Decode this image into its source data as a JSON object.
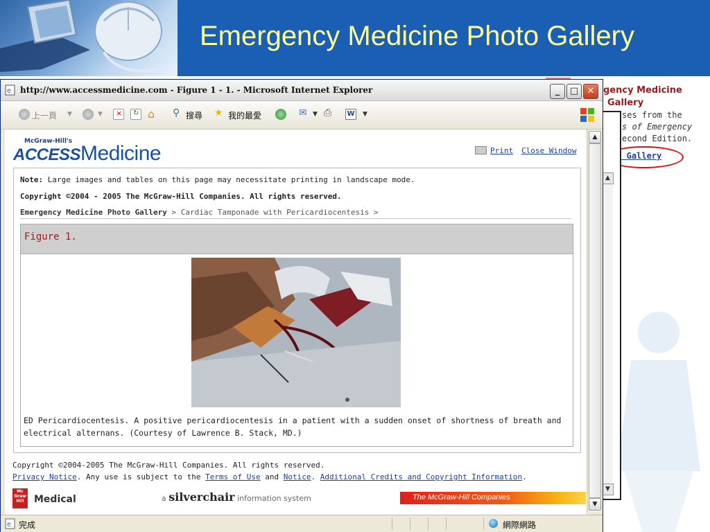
{
  "slide": {
    "title": "Emergency Medicine Photo Gallery"
  },
  "background_page": {
    "title_line1": "gency Medicine",
    "title_line2": "Gallery",
    "text_line1": "ses from the",
    "text_line2": "s of Emergency",
    "text_line3": "econd Edition.",
    "link": "to Gallery"
  },
  "window": {
    "title": "http://www.accessmedicine.com - Figure 1 - 1. - Microsoft Internet Explorer",
    "minimize": "_",
    "maximize": "□",
    "close": "✕"
  },
  "toolbar": {
    "back_label": "上一頁",
    "search_label": "搜尋",
    "favorites_label": "我的最愛"
  },
  "page": {
    "logo_small": "McGraw-Hill's",
    "logo_access": "ACCESS",
    "logo_medicine": "Medicine",
    "print_label": "Print",
    "close_window_label": "Close Window",
    "note_label": "Note:",
    "note_text": "Large images and tables on this page may necessitate printing in landscape mode.",
    "copyright_top": "Copyright ©2004 - 2005 The McGraw-Hill Companies.  All rights reserved.",
    "breadcrumb_home": "Emergency Medicine Photo Gallery",
    "breadcrumb_rest": " > Cardiac Tamponade with Pericardiocentesis >",
    "figure_title": "Figure 1.",
    "caption": "ED Pericardiocentesis. A positive pericardiocentesis in a patient with a sudden onset of shortness of breath and electrical alternans. (Courtesy of Lawrence B. Stack, MD.)",
    "footer_copyright": "Copyright ©2004-2005 The McGraw-Hill Companies.  All rights reserved.",
    "footer_privacy": "Privacy Notice",
    "footer_text1": ". Any use is subject to the ",
    "footer_terms": "Terms of Use",
    "footer_and": " and ",
    "footer_notice": "Notice",
    "footer_dot": ".  ",
    "footer_credits": "Additional Credits and Copyright Information",
    "footer_end": ".",
    "mcgraw_logo": "Mc Graw Hill",
    "medical": "Medical",
    "silverchair_a": "a ",
    "silverchair_name": "silverchair",
    "silverchair_rest": " information system",
    "mh_companies": "The McGraw-Hill Companies"
  },
  "status": {
    "text": "完成",
    "zone": "網際網路"
  },
  "colors": {
    "slide_header": "#1a5fb4",
    "slide_title": "#ffff99",
    "link": "#1c3f9c",
    "figure_title": "#9b1a1a"
  }
}
